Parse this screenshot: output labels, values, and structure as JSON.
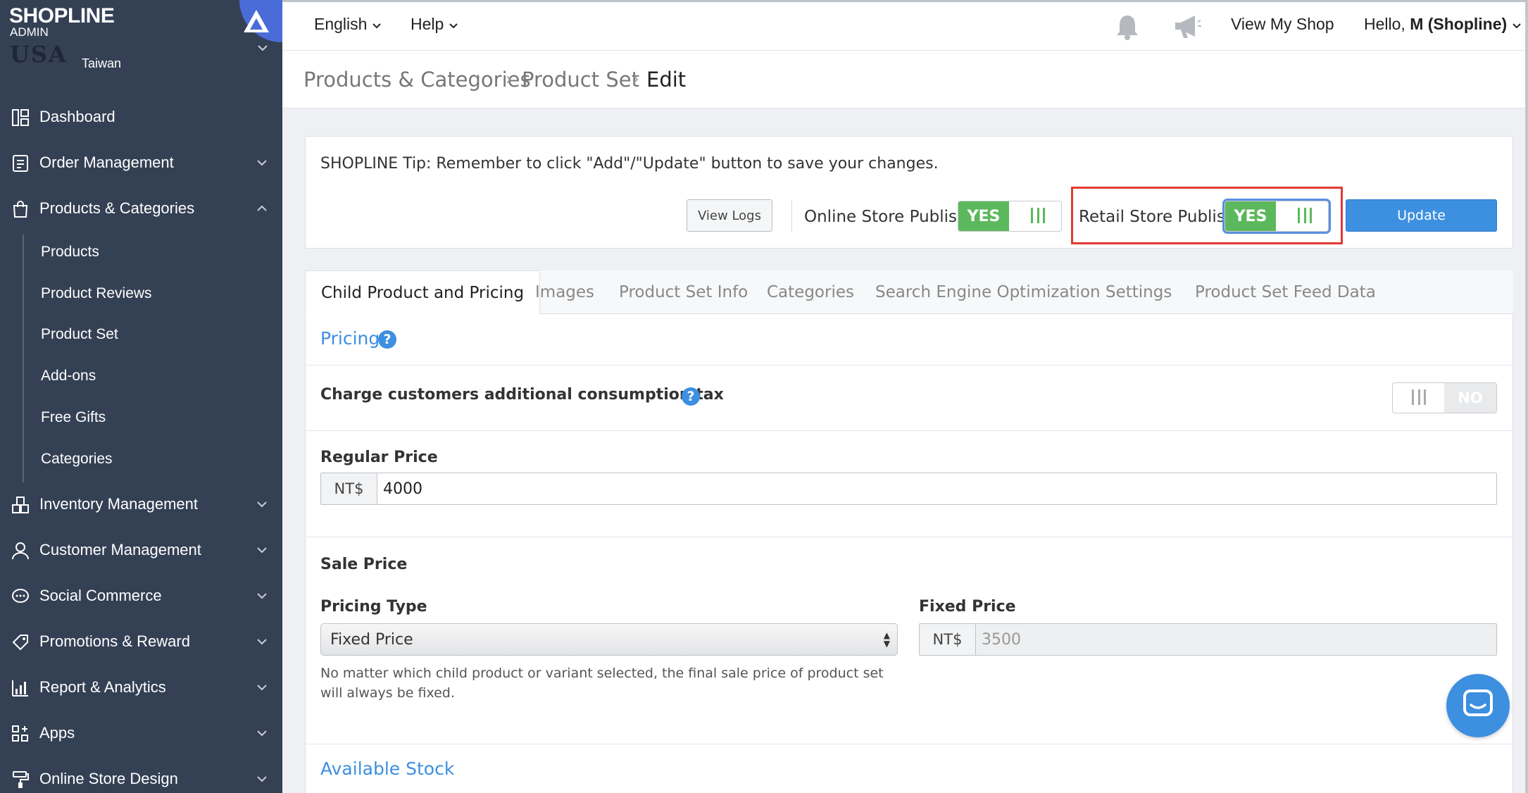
{
  "brand": {
    "name": "SHOPLINE",
    "sub": "ADMIN"
  },
  "shop": {
    "logo": "USA",
    "region": "Taiwan"
  },
  "sidebar": {
    "items": [
      {
        "label": "Dashboard"
      },
      {
        "label": "Order Management"
      },
      {
        "label": "Products & Categories"
      },
      {
        "label": "Inventory Management"
      },
      {
        "label": "Customer Management"
      },
      {
        "label": "Social Commerce"
      },
      {
        "label": "Promotions & Reward"
      },
      {
        "label": "Report & Analytics"
      },
      {
        "label": "Apps"
      },
      {
        "label": "Online Store Design"
      }
    ],
    "sub_items": [
      {
        "label": "Products"
      },
      {
        "label": "Product Reviews"
      },
      {
        "label": "Product Set"
      },
      {
        "label": "Add-ons"
      },
      {
        "label": "Free Gifts"
      },
      {
        "label": "Categories"
      }
    ]
  },
  "topbar": {
    "language": "English",
    "help": "Help",
    "view_shop": "View My Shop",
    "greeting": "Hello,",
    "user": "M (Shopline)"
  },
  "breadcrumb": [
    "Products & Categories",
    "Product Set",
    "Edit"
  ],
  "tip": {
    "text": "SHOPLINE Tip: Remember to click \"Add\"/\"Update\" button to save your changes.",
    "view_logs": "View Logs",
    "online_publish_label": "Online Store Publish",
    "online_publish_value": "YES",
    "retail_publish_label": "Retail Store Publish",
    "retail_publish_value": "YES",
    "update": "Update"
  },
  "tabs": [
    {
      "label": "Child Product and Pricing"
    },
    {
      "label": "Images"
    },
    {
      "label": "Product Set Info"
    },
    {
      "label": "Categories"
    },
    {
      "label": "Search Engine Optimization"
    },
    {
      "label": "Settings"
    },
    {
      "label": "Product Set Feed Data"
    }
  ],
  "pricing": {
    "section_title": "Pricing",
    "tax_label": "Charge customers additional consumption tax",
    "tax_value": "NO",
    "regular_price_label": "Regular Price",
    "currency": "NT$",
    "regular_price": "4000",
    "sale_price_label": "Sale Price",
    "pricing_type_label": "Pricing Type",
    "pricing_type": "Fixed Price",
    "fixed_price_label": "Fixed Price",
    "fixed_price": "3500",
    "help_text": "No matter which child product or variant selected, the final sale price of product set will always be fixed."
  },
  "stock": {
    "section_title": "Available Stock"
  },
  "colors": {
    "sidebar": "#344054",
    "accent": "#3d8fe0",
    "yes": "#5cb85c",
    "highlight": "#e23a32"
  }
}
